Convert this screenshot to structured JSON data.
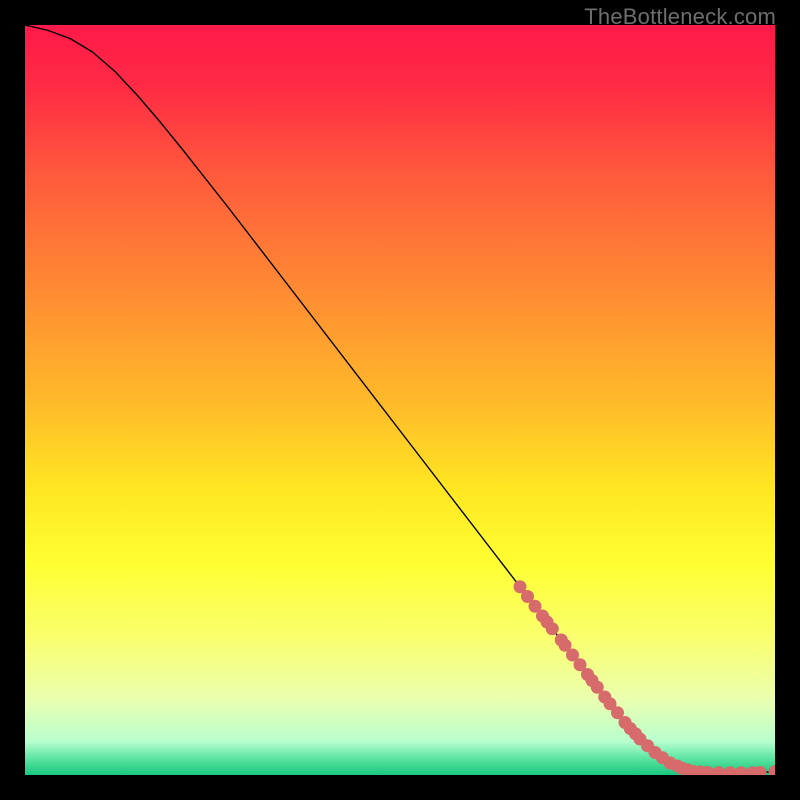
{
  "watermark": "TheBottleneck.com",
  "chart_data": {
    "type": "line",
    "title": "",
    "xlabel": "",
    "ylabel": "",
    "xlim": [
      0,
      100
    ],
    "ylim": [
      0,
      100
    ],
    "grid": false,
    "legend": false,
    "background_gradient": {
      "stops": [
        {
          "pos": 0.0,
          "color": "#ff1a49"
        },
        {
          "pos": 0.08,
          "color": "#ff2a45"
        },
        {
          "pos": 0.2,
          "color": "#ff5a3c"
        },
        {
          "pos": 0.35,
          "color": "#ff8a33"
        },
        {
          "pos": 0.5,
          "color": "#ffb92a"
        },
        {
          "pos": 0.62,
          "color": "#ffe722"
        },
        {
          "pos": 0.72,
          "color": "#ffff33"
        },
        {
          "pos": 0.82,
          "color": "#f9ff70"
        },
        {
          "pos": 0.9,
          "color": "#eaffb0"
        },
        {
          "pos": 0.955,
          "color": "#b8ffce"
        },
        {
          "pos": 0.98,
          "color": "#55e29e"
        },
        {
          "pos": 1.0,
          "color": "#19c77e"
        }
      ]
    },
    "series": [
      {
        "name": "curve",
        "stroke": "#000000",
        "stroke_width": 1.4,
        "x": [
          0,
          3,
          6,
          9,
          12,
          15,
          18,
          21,
          24,
          27,
          30,
          33,
          36,
          39,
          42,
          45,
          48,
          51,
          54,
          57,
          60,
          63,
          66,
          69,
          72,
          75,
          78,
          80,
          82,
          84,
          86,
          87.5,
          89,
          91,
          93,
          95,
          97,
          100
        ],
        "y": [
          100,
          99.3,
          98.2,
          96.4,
          93.8,
          90.6,
          87.1,
          83.4,
          79.6,
          75.8,
          71.9,
          68.0,
          64.1,
          60.2,
          56.3,
          52.4,
          48.5,
          44.6,
          40.7,
          36.8,
          32.9,
          29.0,
          25.1,
          21.2,
          17.3,
          13.4,
          9.5,
          7.0,
          4.8,
          3.0,
          1.6,
          0.9,
          0.5,
          0.35,
          0.3,
          0.3,
          0.3,
          0.45
        ]
      }
    ],
    "markers": {
      "name": "highlighted-points",
      "color": "#d76a6a",
      "radius": 6.5,
      "points": [
        {
          "x": 66.0,
          "y": 25.1
        },
        {
          "x": 67.0,
          "y": 23.8
        },
        {
          "x": 68.0,
          "y": 22.5
        },
        {
          "x": 69.0,
          "y": 21.2
        },
        {
          "x": 69.6,
          "y": 20.4
        },
        {
          "x": 70.3,
          "y": 19.5
        },
        {
          "x": 71.5,
          "y": 18.0
        },
        {
          "x": 72.0,
          "y": 17.3
        },
        {
          "x": 73.0,
          "y": 16.0
        },
        {
          "x": 74.0,
          "y": 14.7
        },
        {
          "x": 75.0,
          "y": 13.4
        },
        {
          "x": 75.6,
          "y": 12.6
        },
        {
          "x": 76.3,
          "y": 11.7
        },
        {
          "x": 77.3,
          "y": 10.4
        },
        {
          "x": 78.0,
          "y": 9.5
        },
        {
          "x": 79.0,
          "y": 8.3
        },
        {
          "x": 80.0,
          "y": 7.0
        },
        {
          "x": 80.7,
          "y": 6.2
        },
        {
          "x": 81.4,
          "y": 5.5
        },
        {
          "x": 82.0,
          "y": 4.8
        },
        {
          "x": 83.0,
          "y": 3.9
        },
        {
          "x": 84.0,
          "y": 3.0
        },
        {
          "x": 85.0,
          "y": 2.3
        },
        {
          "x": 86.0,
          "y": 1.6
        },
        {
          "x": 87.0,
          "y": 1.2
        },
        {
          "x": 87.6,
          "y": 0.9
        },
        {
          "x": 88.3,
          "y": 0.7
        },
        {
          "x": 89.0,
          "y": 0.5
        },
        {
          "x": 90.0,
          "y": 0.42
        },
        {
          "x": 91.0,
          "y": 0.35
        },
        {
          "x": 92.5,
          "y": 0.32
        },
        {
          "x": 94.0,
          "y": 0.3
        },
        {
          "x": 95.5,
          "y": 0.3
        },
        {
          "x": 97.0,
          "y": 0.3
        },
        {
          "x": 98.0,
          "y": 0.35
        },
        {
          "x": 100.0,
          "y": 0.45
        }
      ]
    }
  }
}
